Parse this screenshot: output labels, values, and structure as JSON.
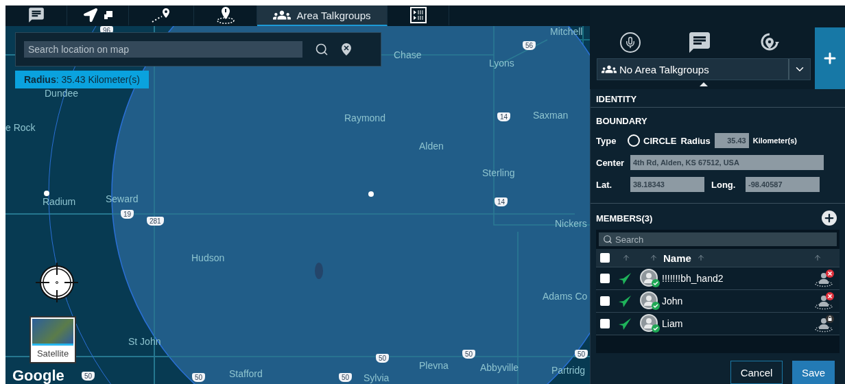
{
  "tabs": [
    {
      "kind": "chat",
      "selected": false
    },
    {
      "kind": "navigate",
      "selected": false
    },
    {
      "kind": "route",
      "selected": false
    },
    {
      "kind": "area-pin",
      "selected": false
    },
    {
      "kind": "talkgroups",
      "label": "Area Talkgroups",
      "selected": true
    },
    {
      "kind": "video",
      "selected": false
    }
  ],
  "map": {
    "search": {
      "placeholder": "Search location on map"
    },
    "radius_badge": "**Radius**: 35.43 Kilometer(s)",
    "towns": [
      "Mitchell",
      "Chase",
      "Lyons",
      "Dundee",
      "e Rock",
      "Raymond",
      "Saxman",
      "Alden",
      "Sterling",
      "Radium",
      "Seward",
      "Nickers",
      "Hudson",
      "Adams Co",
      "St John",
      "Stafford",
      "Sylvia",
      "Plevna",
      "Abbyville",
      "Partridg"
    ],
    "shields": [
      "96",
      "56",
      "14",
      "14",
      "19",
      "281",
      "50",
      "50",
      "50",
      "50",
      "50",
      "50"
    ],
    "satellite": "Satellite",
    "logo": "Google"
  },
  "panel": {
    "modes": [
      {
        "kind": "mic"
      },
      {
        "kind": "chat"
      },
      {
        "kind": "location"
      }
    ],
    "dropdown": "No Area Talkgroups",
    "identity": "IDENTITY",
    "boundary": {
      "title": "BOUNDARY",
      "type_label": "Type",
      "type_value": "CIRCLE",
      "type_selected": false,
      "radius_label": "Radius",
      "radius_value": "35.43",
      "unit": "Kilometer(s)",
      "center_label": "Center",
      "center_value": "4th Rd, Alden, KS 67512, USA",
      "lat_label": "Lat.",
      "lat_value": "38.18343",
      "long_label": "Long.",
      "long_value": "-98.40587"
    },
    "members": {
      "title": "MEMBERS(3)",
      "search": {
        "placeholder": "Search"
      },
      "header_checked": false,
      "name_column": "Name",
      "rows": [
        {
          "name": "!!!!!!!bh_hand2",
          "checked": false,
          "kind": "removed"
        },
        {
          "name": "John",
          "checked": false,
          "kind": "removed"
        },
        {
          "name": "Liam",
          "checked": false,
          "kind": "locked"
        }
      ]
    },
    "buttons": {
      "cancel": "Cancel",
      "save": "Save"
    }
  }
}
